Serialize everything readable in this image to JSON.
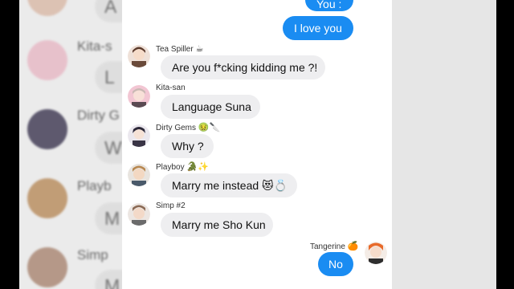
{
  "background_left": {
    "rows": [
      {
        "name": "",
        "text": "A"
      },
      {
        "name": "Kita-s",
        "text": "L"
      },
      {
        "name": "Dirty G",
        "text": "W"
      },
      {
        "name": "Playb",
        "text": "M"
      },
      {
        "name": "Simp",
        "text": "M"
      }
    ]
  },
  "messages": {
    "prev_out_top": "You :",
    "love_you": "I love you",
    "m1": {
      "sender": "Tea Spiller",
      "sender_emoji": "☕",
      "text": "Are you f*cking kidding me ?!"
    },
    "m2": {
      "sender": "Kita-san",
      "text": "Language Suna"
    },
    "m3": {
      "sender": "Dirty Gems",
      "sender_emoji": "🤢🔪",
      "text": "Why ?"
    },
    "m4": {
      "sender": "Playboy",
      "sender_emoji": "🐊✨",
      "text": "Marry me instead",
      "text_emoji": "😻💍"
    },
    "m5": {
      "sender": "Simp #2",
      "text": "Marry me Sho Kun"
    },
    "m6": {
      "sender": "Tangerine",
      "sender_emoji": "🍊",
      "text": "No"
    }
  },
  "colors": {
    "outgoing": "#1a8cf2",
    "incoming": "#eeeef0",
    "panel": "#ffffff"
  }
}
